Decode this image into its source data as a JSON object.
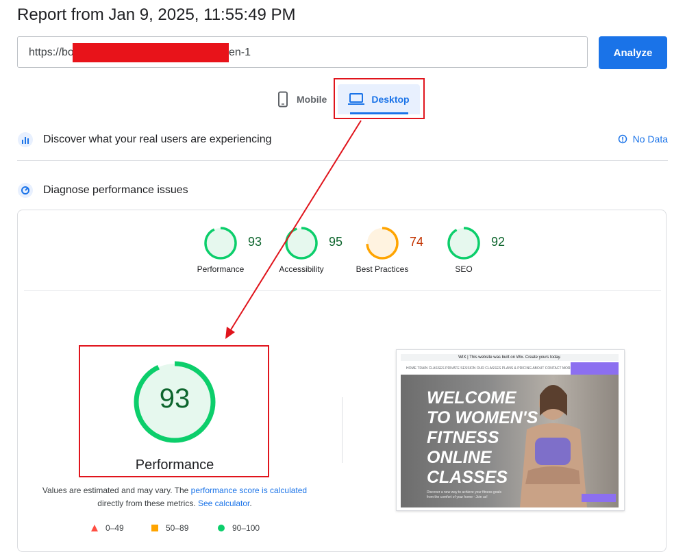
{
  "report": {
    "title": "Report from Jan 9, 2025, 11:55:49 PM"
  },
  "url_input": {
    "value_start": "https://bo",
    "value_end": "en-1"
  },
  "analyze_button": {
    "label": "Analyze"
  },
  "device_tabs": [
    {
      "label": "Mobile",
      "icon": "smartphone-icon",
      "selected": false
    },
    {
      "label": "Desktop",
      "icon": "laptop-icon",
      "selected": true
    }
  ],
  "real_users": {
    "title": "Discover what your real users are experiencing",
    "status": "No Data"
  },
  "diagnose": {
    "title": "Diagnose performance issues"
  },
  "scores": [
    {
      "label": "Performance",
      "value": 93,
      "color": "#0cce6b"
    },
    {
      "label": "Accessibility",
      "value": 95,
      "color": "#0cce6b"
    },
    {
      "label": "Best Practices",
      "value": 74,
      "color": "#ffa400"
    },
    {
      "label": "SEO",
      "value": 92,
      "color": "#0cce6b"
    }
  ],
  "main_score": {
    "label": "Performance",
    "value": 93
  },
  "note": {
    "text1": "Values are estimated and may vary. The ",
    "link1": "performance score is calculated",
    "text2": "directly from these metrics. ",
    "link2": "See calculator",
    "text3": "."
  },
  "legend": [
    {
      "range": "0–49",
      "color": "#ff4e42",
      "shape": "triangle"
    },
    {
      "range": "50–89",
      "color": "#ffa400",
      "shape": "square"
    },
    {
      "range": "90–100",
      "color": "#0cce6b",
      "shape": "circle"
    }
  ],
  "thumbnail": {
    "banner": "WIX | This website was built on Wix. Create yours today.",
    "nav": "HOME   TRAIN CLASSES   PRIVATE SESSION   OUR CLASSES   PLANS & PRICING   ABOUT   CONTACT   MORE",
    "headline": "WELCOME TO WOMEN'S FITNESS ONLINE CLASSES",
    "subtext": "Discover a new way to achieve your fitness goals from the comfort of your home - Join us!"
  },
  "colors": {
    "accent": "#1a73e8",
    "callout": "#e0141c"
  }
}
